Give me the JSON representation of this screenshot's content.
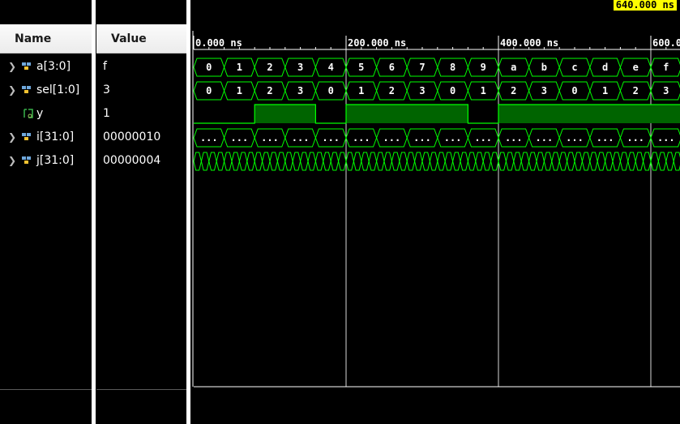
{
  "columns": {
    "name": "Name",
    "value": "Value"
  },
  "cursor_time": "640.000 ns",
  "signals": [
    {
      "name": "a[3:0]",
      "value": "f",
      "kind": "bus",
      "expandable": true
    },
    {
      "name": "sel[1:0]",
      "value": "3",
      "kind": "bus",
      "expandable": true
    },
    {
      "name": "y",
      "value": "1",
      "kind": "bit",
      "expandable": false
    },
    {
      "name": "i[31:0]",
      "value": "00000010",
      "kind": "bus",
      "expandable": true
    },
    {
      "name": "j[31:0]",
      "value": "00000004",
      "kind": "bus",
      "expandable": true
    }
  ],
  "time_axis": {
    "ticks": [
      "0.000 ns",
      "200.000 ns",
      "400.000 ns",
      "600.0"
    ],
    "visible_range_ns": [
      0,
      640
    ]
  },
  "waveforms": {
    "a": [
      "0",
      "1",
      "2",
      "3",
      "4",
      "5",
      "6",
      "7",
      "8",
      "9",
      "a",
      "b",
      "c",
      "d",
      "e",
      "f"
    ],
    "sel": [
      "0",
      "1",
      "2",
      "3",
      "0",
      "1",
      "2",
      "3",
      "0",
      "1",
      "2",
      "3",
      "0",
      "1",
      "2",
      "3"
    ],
    "y": [
      {
        "from_ns": 0,
        "to_ns": 80,
        "level": 0
      },
      {
        "from_ns": 80,
        "to_ns": 160,
        "level": 1
      },
      {
        "from_ns": 160,
        "to_ns": 200,
        "level": 0
      },
      {
        "from_ns": 200,
        "to_ns": 360,
        "level": 1
      },
      {
        "from_ns": 360,
        "to_ns": 400,
        "level": 0
      },
      {
        "from_ns": 400,
        "to_ns": 640,
        "level": 1
      }
    ],
    "i_label": "...",
    "i_segments": 16,
    "j_segments": 64
  },
  "colors": {
    "wave": "#00ff00",
    "fill": "#006400",
    "grid": "#ffffff",
    "cursor_bg": "#ffff00",
    "text": "#ffffff"
  }
}
